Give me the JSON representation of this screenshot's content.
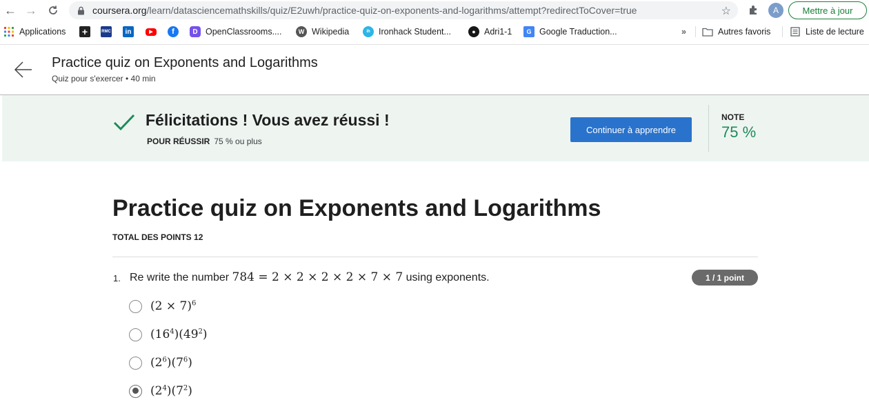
{
  "browser": {
    "url_host": "coursera.org",
    "url_path": "/learn/datasciencemathskills/quiz/E2uwh/practice-quiz-on-exponents-and-logarithms/attempt?redirectToCover=true",
    "profile_initial": "A",
    "update_label": "Mettre à jour"
  },
  "bookmarks": {
    "items": [
      {
        "label": "Applications",
        "icon": "apps-grid-icon"
      },
      {
        "label": "",
        "icon": "plus-icon"
      },
      {
        "label": "",
        "icon": "rmc-icon"
      },
      {
        "label": "",
        "icon": "linkedin-icon"
      },
      {
        "label": "",
        "icon": "youtube-icon"
      },
      {
        "label": "",
        "icon": "facebook-icon"
      },
      {
        "label": "OpenClassrooms....",
        "icon": "openclassrooms-icon"
      },
      {
        "label": "Wikipedia",
        "icon": "wikipedia-icon"
      },
      {
        "label": "Ironhack Student...",
        "icon": "ironhack-icon"
      },
      {
        "label": "Adri1-1",
        "icon": "github-icon"
      },
      {
        "label": "Google Traduction...",
        "icon": "google-translate-icon"
      }
    ],
    "more": "»",
    "other_favorites": "Autres favoris",
    "reading_list": "Liste de lecture"
  },
  "header": {
    "title": "Practice quiz on Exponents and Logarithms",
    "subtitle": "Quiz pour s'exercer • 40 min"
  },
  "banner": {
    "message": "Félicitations ! Vous avez réussi !",
    "pass_key": "POUR RÉUSSIR",
    "pass_value": "75 % ou plus",
    "continue_label": "Continuer à apprendre",
    "note_label": "NOTE",
    "note_value": "75 %",
    "accent_color": "#1e8a5a"
  },
  "quiz": {
    "title": "Practice quiz on Exponents and Logarithms",
    "total_points": "TOTAL DES POINTS 12",
    "questions": [
      {
        "number": "1.",
        "text_before": "Re write the number ",
        "math": "784 = 2 × 2 × 2 × 2 × 7 × 7",
        "text_after": " using exponents.",
        "points": "1 / 1 point",
        "options": [
          {
            "base_html": "(2 × 7)<sup>6</sup>",
            "selected": false
          },
          {
            "base_html": "(16<sup>4</sup>)(49<sup>2</sup>)",
            "selected": false
          },
          {
            "base_html": "(2<sup>6</sup>)(7<sup>6</sup>)",
            "selected": false
          },
          {
            "base_html": "(2<sup>4</sup>)(7<sup>2</sup>)",
            "selected": true
          }
        ]
      }
    ]
  }
}
